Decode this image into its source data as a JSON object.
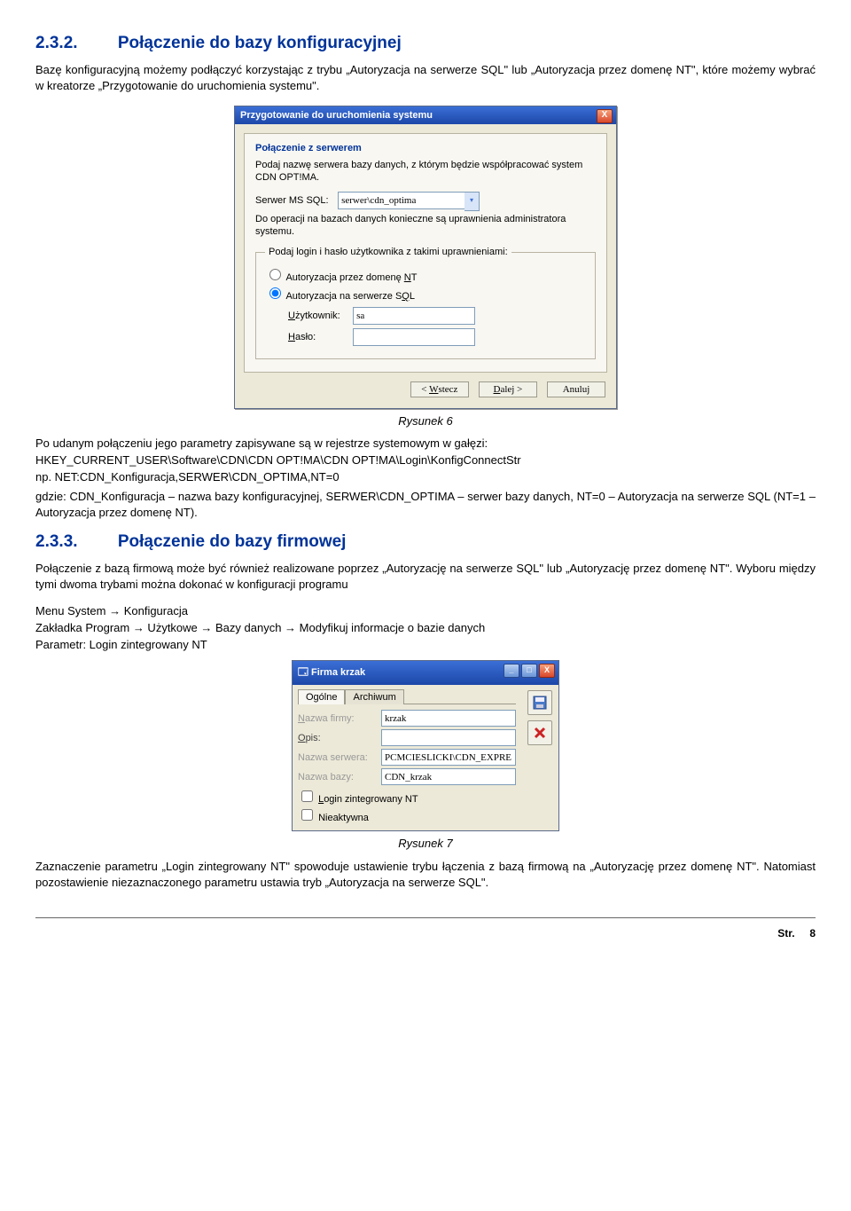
{
  "sec1": {
    "num": "2.3.2.",
    "title": "Połączenie do bazy konfiguracyjnej",
    "para": "Bazę konfiguracyjną możemy podłączyć korzystając z trybu „Autoryzacja na serwerze SQL\" lub „Autoryzacja przez domenę NT\", które możemy wybrać w kreatorze „Przygotowanie do uruchomienia systemu\"."
  },
  "dlg1": {
    "title": "Przygotowanie do uruchomienia systemu",
    "close_x": "X",
    "panel_title": "Połączenie z serwerem",
    "instr": "Podaj nazwę serwera bazy danych, z którym będzie współpracować system CDN OPT!MA.",
    "serwer_label": "Serwer MS SQL:",
    "serwer_value": "serwer\\cdn_optima",
    "perm_note": "Do operacji na bazach danych konieczne są uprawnienia administratora systemu.",
    "legend": "Podaj login i hasło użytkownika z takimi uprawnieniami:",
    "radio_nt": "Autoryzacja przez domenę NT",
    "radio_sql": "Autoryzacja na serwerze SQL",
    "user_label": "Użytkownik:",
    "user_value": "sa",
    "pass_label": "Hasło:",
    "pass_value": "",
    "btn_back": "< Wstecz",
    "btn_next": "Dalej >",
    "btn_cancel": "Anuluj"
  },
  "cap1": "Rysunek 6",
  "after_fig1": {
    "line1": "Po udanym połączeniu jego parametry zapisywane są w rejestrze systemowym w gałęzi:",
    "reg": "HKEY_CURRENT_USER\\Software\\CDN\\CDN OPT!MA\\CDN OPT!MA\\Login\\KonfigConnectStr",
    "ex": "np. NET:CDN_Konfiguracja,SERWER\\CDN_OPTIMA,NT=0",
    "desc": "gdzie: CDN_Konfiguracja – nazwa bazy konfiguracyjnej, SERWER\\CDN_OPTIMA – serwer bazy danych, NT=0 – Autoryzacja na serwerze SQL (NT=1 – Autoryzacja przez domenę NT)."
  },
  "sec2": {
    "num": "2.3.3.",
    "title": "Połączenie do bazy firmowej",
    "p1": "Połączenie z bazą firmową może być również realizowane poprzez „Autoryzację na serwerze SQL\" lub „Autoryzację przez domenę NT\". Wyboru między tymi dwoma trybami można dokonać w konfiguracji programu",
    "p2": "Menu System → Konfiguracja",
    "p3": "Zakładka Program → Użytkowe → Bazy danych → Modyfikuj informacje o bazie danych",
    "p4": "Parametr: Login zintegrowany NT"
  },
  "dlg2": {
    "title": "Firma krzak",
    "tab1": "Ogólne",
    "tab2": "Archiwum",
    "l_name": "Nazwa firmy:",
    "v_name": "krzak",
    "l_opis": "Opis:",
    "v_opis": "",
    "l_srv": "Nazwa serwera:",
    "v_srv": "PCMCIESLICKI\\CDN_EXPRE",
    "l_db": "Nazwa bazy:",
    "v_db": "CDN_krzak",
    "chk1": "Login zintegrowany NT",
    "chk2": "Nieaktywna"
  },
  "cap2": "Rysunek 7",
  "closing": "Zaznaczenie parametru „Login zintegrowany NT\" spowoduje ustawienie trybu łączenia z bazą firmową na „Autoryzację przez domenę NT\". Natomiast pozostawienie niezaznaczonego parametru ustawia tryb „Autoryzacja na serwerze SQL\".",
  "footer": {
    "label": "Str.",
    "page": "8"
  }
}
